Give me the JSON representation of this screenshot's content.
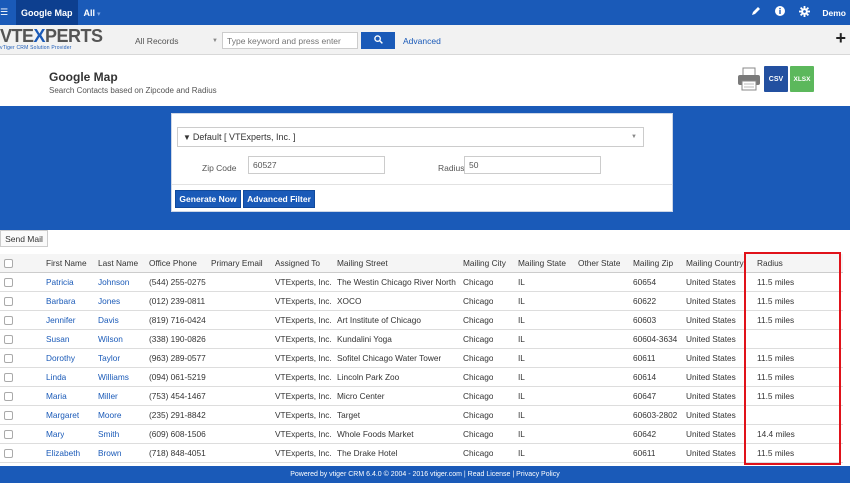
{
  "topbar": {
    "app_title": "Google Map",
    "all_label": "All",
    "user": "Demo"
  },
  "brand": {
    "name_a": "VTE",
    "name_x": "X",
    "name_b": "PERTS",
    "tagline": "vTiger CRM Solution Provider"
  },
  "search": {
    "scope": "All Records",
    "placeholder": "Type keyword and press enter",
    "advanced": "Advanced"
  },
  "page": {
    "title": "Google Map",
    "subtitle": "Search Contacts based on Zipcode and Radius"
  },
  "export": {
    "csv": "CSV",
    "xlsx": "XLSX"
  },
  "filter": {
    "selected": "Default [ VTExperts, Inc. ]",
    "zip_label": "Zip Code",
    "zip_value": "60527",
    "radius_label": "Radius",
    "radius_value": "50",
    "generate": "Generate Now",
    "advanced_filter": "Advanced Filter"
  },
  "send_mail": "Send Mail",
  "table": {
    "headers": [
      "First Name",
      "Last Name",
      "Office Phone",
      "Primary Email",
      "Assigned To",
      "Mailing Street",
      "Mailing City",
      "Mailing State",
      "Other State",
      "Mailing Zip",
      "Mailing Country",
      "Radius"
    ],
    "rows": [
      [
        "Patricia",
        "Johnson",
        "(544) 255-0275",
        "",
        "VTExperts, Inc.",
        "The Westin Chicago River North",
        "Chicago",
        "IL",
        "",
        "60654",
        "United States",
        "11.5 miles"
      ],
      [
        "Barbara",
        "Jones",
        "(012) 239-0811",
        "",
        "VTExperts, Inc.",
        "XOCO",
        "Chicago",
        "IL",
        "",
        "60622",
        "United States",
        "11.5 miles"
      ],
      [
        "Jennifer",
        "Davis",
        "(819) 716-0424",
        "",
        "VTExperts, Inc.",
        "Art Institute of Chicago",
        "Chicago",
        "IL",
        "",
        "60603",
        "United States",
        "11.5 miles"
      ],
      [
        "Susan",
        "Wilson",
        "(338) 190-0826",
        "",
        "VTExperts, Inc.",
        "Kundalini Yoga",
        "Chicago",
        "IL",
        "",
        "60604-3634",
        "United States",
        ""
      ],
      [
        "Dorothy",
        "Taylor",
        "(963) 289-0577",
        "",
        "VTExperts, Inc.",
        "Sofitel Chicago Water Tower",
        "Chicago",
        "IL",
        "",
        "60611",
        "United States",
        "11.5 miles"
      ],
      [
        "Linda",
        "Williams",
        "(094) 061-5219",
        "",
        "VTExperts, Inc.",
        "Lincoln Park Zoo",
        "Chicago",
        "IL",
        "",
        "60614",
        "United States",
        "11.5 miles"
      ],
      [
        "Maria",
        "Miller",
        "(753) 454-1467",
        "",
        "VTExperts, Inc.",
        "Micro Center",
        "Chicago",
        "IL",
        "",
        "60647",
        "United States",
        "11.5 miles"
      ],
      [
        "Margaret",
        "Moore",
        "(235) 291-8842",
        "",
        "VTExperts, Inc.",
        "Target",
        "Chicago",
        "IL",
        "",
        "60603-2802",
        "United States",
        ""
      ],
      [
        "Mary",
        "Smith",
        "(609) 608-1506",
        "",
        "VTExperts, Inc.",
        "Whole Foods Market",
        "Chicago",
        "IL",
        "",
        "60642",
        "United States",
        "14.4 miles"
      ],
      [
        "Elizabeth",
        "Brown",
        "(718) 848-4051",
        "",
        "VTExperts, Inc.",
        "The Drake Hotel",
        "Chicago",
        "IL",
        "",
        "60611",
        "United States",
        "11.5 miles"
      ]
    ]
  },
  "footer": "Powered by vtiger CRM 6.4.0 © 2004 - 2016  vtiger.com | Read License | Privacy Policy",
  "colors": {
    "brand_blue": "#1a5ab8",
    "highlight_red": "#e0121a"
  },
  "icons": [
    "pencil-icon",
    "info-icon",
    "gear-icon",
    "plus-icon",
    "search-icon",
    "printer-icon"
  ]
}
